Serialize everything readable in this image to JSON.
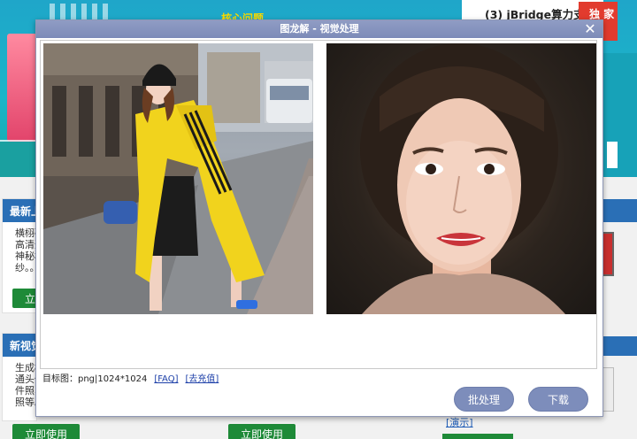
{
  "background": {
    "banner_title": "核心问题",
    "top_right_text": "(3) jBridge算力支持",
    "badge_text": "独 家 布",
    "cards": [
      {
        "header": "最新上",
        "text": "横栩磁\n高清迈\n神秘横\n纱。。",
        "button": "立"
      },
      {
        "header": "新视觉",
        "text": "生成椒\n通头像\n件照、\n照等。",
        "button": "立即使用"
      },
      {
        "header": "",
        "text": "",
        "button": "立即使用"
      }
    ],
    "demo_link": "[演示]"
  },
  "dialog": {
    "title": "图龙解 - 视觉处理",
    "close_label": "✕",
    "status_prefix": "目标图：png|1024*1024",
    "faq_link": "[FAQ]",
    "recharge_link": "[去充值]",
    "batch_button": "批处理",
    "download_button": "下载"
  }
}
